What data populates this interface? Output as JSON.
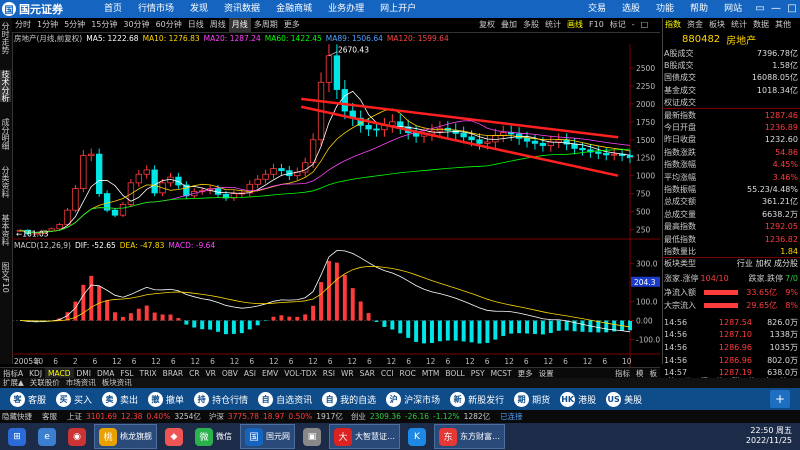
{
  "app": {
    "logo_text": "国元证券",
    "menu": [
      "首页",
      "行情市场",
      "发现",
      "资讯数据",
      "金融商城",
      "业务办理",
      "网上开户"
    ],
    "right_menu": [
      "交易",
      "选股",
      "功能",
      "帮助",
      "网站"
    ],
    "window_controls": [
      "▭",
      "—",
      "□",
      "✕"
    ]
  },
  "period_tabs": [
    "分时",
    "1分钟",
    "5分钟",
    "15分钟",
    "30分钟",
    "60分钟",
    "日线",
    "周线",
    "月线",
    "多周期",
    "更多"
  ],
  "period_active": "月线",
  "chart_tools": [
    "复权",
    "叠加",
    "多股",
    "统计",
    "画线",
    "F10",
    "标记",
    "-",
    "□"
  ],
  "chart_tools_active": "画线",
  "left_vtabs": [
    "分时走势",
    "技术分析",
    "成分明细",
    "分类资料",
    "基本资料",
    "图文F10"
  ],
  "indicator_line": {
    "name": "房地产(月线,前复权)",
    "ma5": "MA5: 1222.68",
    "ma10": "MA10: 1276.83",
    "ma20": "MA20: 1287.24",
    "ma60": "MA60: 1422.45",
    "ma89": "MA89: 1506.64",
    "ma120": "MA120: 1599.64",
    "colors": {
      "ma5": "#ffffff",
      "ma10": "#ffd700",
      "ma20": "#ff44ff",
      "ma60": "#00ff00",
      "ma89": "#4fa3ff",
      "ma120": "#ff4444"
    }
  },
  "macd_line": {
    "name": "MACD(12,26,9)",
    "dif": "DIF: -52.65",
    "dea": "DEA: -47.83",
    "macd": "MACD: -9.64"
  },
  "chart_data": [
    {
      "type": "candlestick",
      "title": "房地产(月线,前复权)",
      "y_ticks": [
        "2500",
        "2250",
        "2000",
        "1750",
        "1500",
        "1250",
        "1000",
        "750",
        "500",
        "250"
      ],
      "annotations": {
        "high": "2670.43",
        "low": "161.03"
      },
      "x_ticks": [
        "2005年",
        "10",
        "6",
        "2",
        "6",
        "12",
        "6",
        "12",
        "6",
        "12",
        "6",
        "12",
        "6",
        "12",
        "6",
        "12",
        "6",
        "12",
        "6",
        "12",
        "6",
        "12",
        "6",
        "12",
        "6",
        "12",
        "6",
        "12",
        "6",
        "12",
        "6",
        "10"
      ],
      "close": [
        240,
        190,
        200,
        230,
        260,
        320,
        520,
        820,
        1280,
        1300,
        750,
        520,
        450,
        600,
        900,
        1020,
        1080,
        760,
        900,
        980,
        870,
        720,
        780,
        790,
        820,
        740,
        690,
        750,
        760,
        880,
        950,
        1020,
        1100,
        1070,
        1000,
        1050,
        1180,
        1500,
        2300,
        2670,
        2200,
        1900,
        1800,
        1700,
        1650,
        1640,
        1700,
        1750,
        1680,
        1600,
        1550,
        1580,
        1620,
        1660,
        1630,
        1590,
        1540,
        1500,
        1450,
        1470,
        1560,
        1600,
        1580,
        1520,
        1480,
        1450,
        1420,
        1470,
        1500,
        1440,
        1380,
        1360,
        1330,
        1310,
        1290,
        1300,
        1280,
        1250
      ],
      "trendlines": [
        {
          "from": [
            1750,
            2070
          ],
          "to": [
            1430,
            1535
          ]
        },
        {
          "from": [
            1680,
            1960
          ],
          "to": [
            1380,
            1000
          ]
        }
      ]
    },
    {
      "type": "macd",
      "title": "MACD(12,26,9)",
      "y_ticks": [
        "300.0",
        "200.0",
        "100.0",
        "0.00",
        "-100.0"
      ],
      "cursor_value": "204.3"
    }
  ],
  "right_panel": {
    "tabs": [
      "指数",
      "资金",
      "板块",
      "统计",
      "数据",
      "其他"
    ],
    "tabs_active": "指数",
    "code": "880482",
    "name": "房地产",
    "stats": [
      {
        "k": "A股成交",
        "v": "7396.78亿",
        "c": ""
      },
      {
        "k": "B股成交",
        "v": "1.58亿",
        "c": ""
      },
      {
        "k": "国债成交",
        "v": "16088.05亿",
        "c": ""
      },
      {
        "k": "基金成交",
        "v": "1018.34亿",
        "c": ""
      },
      {
        "k": "权证成交",
        "v": "",
        "c": ""
      },
      {
        "k": "最新指数",
        "v": "1287.46",
        "c": "red"
      },
      {
        "k": "今日开盘",
        "v": "1236.89",
        "c": "red"
      },
      {
        "k": "昨日收盘",
        "v": "1232.60",
        "c": ""
      },
      {
        "k": "指数涨跌",
        "v": "54.86",
        "c": "red"
      },
      {
        "k": "指数涨幅",
        "v": "4.45%",
        "c": "red"
      },
      {
        "k": "平均涨幅",
        "v": "3.46%",
        "c": "red"
      },
      {
        "k": "指数振幅",
        "v": "55.23/4.48%",
        "c": ""
      },
      {
        "k": "总成交额",
        "v": "361.21亿",
        "c": ""
      },
      {
        "k": "总成交量",
        "v": "6638.2万",
        "c": ""
      },
      {
        "k": "最高指数",
        "v": "1292.05",
        "c": "red"
      },
      {
        "k": "最低指数",
        "v": "1236.82",
        "c": "red"
      },
      {
        "k": "指数量比",
        "v": "1.84",
        "c": "yellow"
      },
      {
        "k": "板块类型",
        "v": "行业 加权 成分股",
        "c": ""
      }
    ],
    "updown": {
      "up_label": "涨家.涨停",
      "up_value": "104/10",
      "down_label": "跌家.跌停",
      "down_value": "7/0"
    },
    "flow": [
      {
        "k": "净流入额",
        "v": "33.65亿",
        "p": "9%"
      },
      {
        "k": "大宗流入",
        "v": "29.65亿",
        "p": "8%"
      }
    ],
    "ticks": [
      {
        "t": "14:56",
        "p": "1287.54",
        "v": "826.0万"
      },
      {
        "t": "14:56",
        "p": "1287.10",
        "v": "1338万"
      },
      {
        "t": "14:56",
        "p": "1286.96",
        "v": "1035万"
      },
      {
        "t": "14:56",
        "p": "1286.96",
        "v": "802.0万"
      },
      {
        "t": "14:57",
        "p": "1287.19",
        "v": "638.0万"
      },
      {
        "t": "14:57",
        "p": "1287.39",
        "v": "4.00万"
      },
      {
        "t": "15:00",
        "p": "1287.18",
        "v": "333.0万"
      },
      {
        "t": "15:00",
        "p": "1287.31",
        "v": "2.17亿"
      },
      {
        "t": "15:00",
        "p": "1287.46",
        "v": "1.26亿"
      }
    ],
    "bottom_tabs": [
      "笔",
      "价",
      "细",
      "势",
      "联",
      "值",
      "主",
      "筹"
    ]
  },
  "index_tabs": [
    "指标A",
    "KDJ",
    "MACD",
    "DMI",
    "DMA",
    "FSL",
    "TRIX",
    "BRAR",
    "CR",
    "VR",
    "OBV",
    "ASI",
    "EMV",
    "VOL-TDX",
    "RSI",
    "WR",
    "SAR",
    "CCI",
    "ROC",
    "MTM",
    "BOLL",
    "PSY",
    "MCST",
    "更多",
    "设置"
  ],
  "index_tabs_active": "MACD",
  "index_right": [
    "指标",
    "模",
    "板"
  ],
  "sub_tabs": [
    "扩展▲",
    "关联股价",
    "市场资讯",
    "板块资讯"
  ],
  "toolbar": [
    {
      "icon": "客",
      "label": "客服"
    },
    {
      "icon": "买",
      "label": "买入"
    },
    {
      "icon": "卖",
      "label": "卖出"
    },
    {
      "icon": "撤",
      "label": "撤单"
    },
    {
      "icon": "持",
      "label": "持仓行情"
    },
    {
      "icon": "自",
      "label": "自选资讯"
    },
    {
      "icon": "自",
      "label": "我的自选"
    },
    {
      "icon": "沪",
      "label": "沪深市场"
    },
    {
      "icon": "新",
      "label": "新股发行"
    },
    {
      "icon": "期",
      "label": "期货"
    },
    {
      "icon": "HK",
      "label": "港股"
    },
    {
      "icon": "US",
      "label": "美股"
    }
  ],
  "status": {
    "hide": "隐藏快捷",
    "service": "客服",
    "sh_label": "上证",
    "sh_value": "3101.69",
    "sh_change": "12.38",
    "sh_pct": "0.40%",
    "sh_amount": "3254亿",
    "hs_label": "沪深",
    "hs_value": "3775.78",
    "hs_change": "18.97",
    "hs_pct": "0.50%",
    "hs_amount": "1917亿",
    "cy_label": "创业",
    "cy_value": "2309.36",
    "cy_change": "-26.16",
    "cy_pct": "-1.12%",
    "cy_amount": "1282亿",
    "conn": "已连接"
  },
  "taskbar": {
    "items": [
      "桃龙旗舰",
      "微信",
      "国元网",
      "大智慧证…",
      "东方财富…"
    ],
    "time": "22:50 周五",
    "date": "2022/11/25"
  }
}
